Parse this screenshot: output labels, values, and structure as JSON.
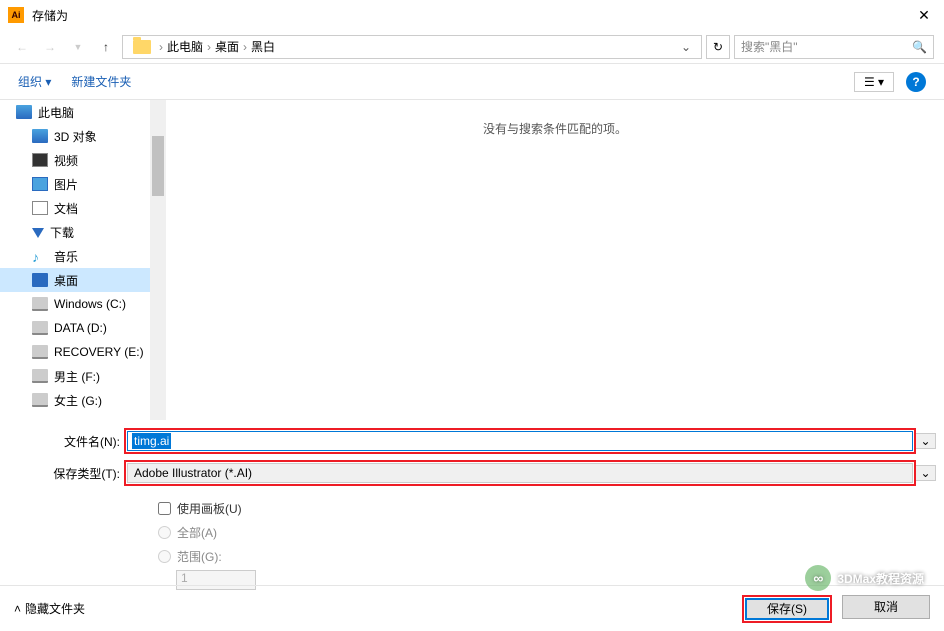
{
  "titlebar": {
    "title": "存储为"
  },
  "breadcrumb": {
    "root": "此电脑",
    "a": "桌面",
    "b": "黑白"
  },
  "search": {
    "placeholder": "搜索\"黑白\""
  },
  "toolbar": {
    "organize": "组织",
    "newfolder": "新建文件夹"
  },
  "sidebar": {
    "items": [
      {
        "label": "此电脑"
      },
      {
        "label": "3D 对象"
      },
      {
        "label": "视频"
      },
      {
        "label": "图片"
      },
      {
        "label": "文档"
      },
      {
        "label": "下载"
      },
      {
        "label": "音乐"
      },
      {
        "label": "桌面"
      },
      {
        "label": "Windows (C:)"
      },
      {
        "label": "DATA (D:)"
      },
      {
        "label": "RECOVERY (E:)"
      },
      {
        "label": "男主 (F:)"
      },
      {
        "label": "女主 (G:)"
      }
    ]
  },
  "main": {
    "empty": "没有与搜索条件匹配的项。"
  },
  "form": {
    "filename_label": "文件名(N):",
    "filename_value": "timg.ai",
    "filetype_label": "保存类型(T):",
    "filetype_value": "Adobe Illustrator (*.AI)"
  },
  "options": {
    "use_artboard": "使用画板(U)",
    "all": "全部(A)",
    "range": "范围(G):",
    "range_value": "1"
  },
  "footer": {
    "hide": "隐藏文件夹",
    "save": "保存(S)",
    "cancel": "取消"
  },
  "watermark": "3DMax教程资源"
}
